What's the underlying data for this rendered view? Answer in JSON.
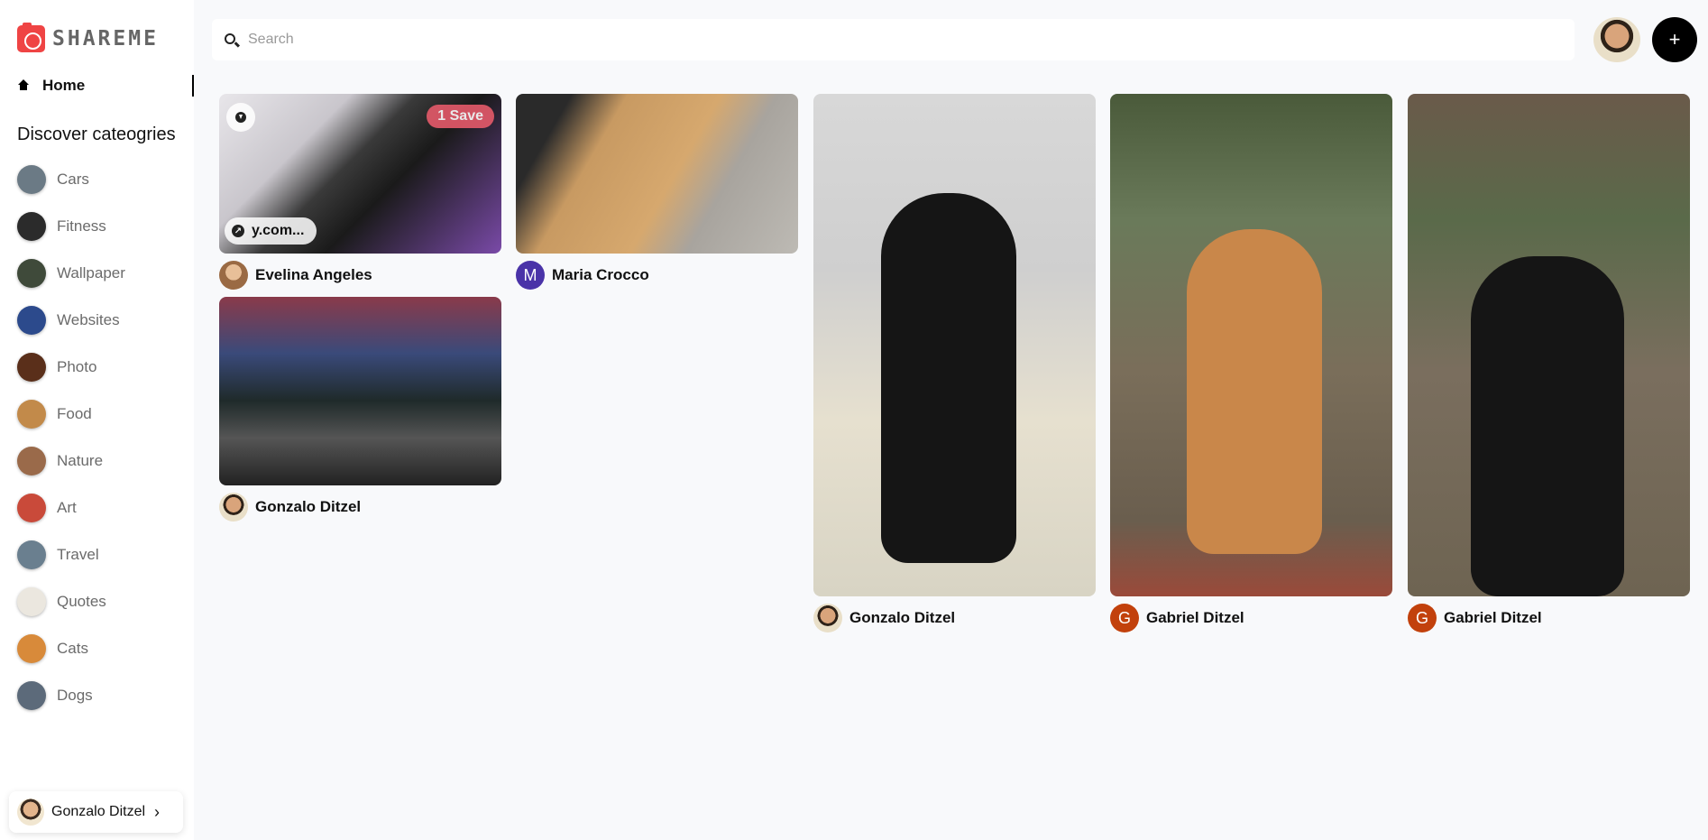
{
  "app": {
    "brand": "SHAREME"
  },
  "sidebar": {
    "home_label": "Home",
    "discover_title": "Discover cateogries",
    "categories": [
      {
        "label": "Cars",
        "thumb": "#6b7a85"
      },
      {
        "label": "Fitness",
        "thumb": "#2b2b2b"
      },
      {
        "label": "Wallpaper",
        "thumb": "#3f4a3a"
      },
      {
        "label": "Websites",
        "thumb": "#2c4a8c"
      },
      {
        "label": "Photo",
        "thumb": "#5a2f1a"
      },
      {
        "label": "Food",
        "thumb": "#c28a4a"
      },
      {
        "label": "Nature",
        "thumb": "#9a6a4a"
      },
      {
        "label": "Art",
        "thumb": "#c94a3a"
      },
      {
        "label": "Travel",
        "thumb": "#6a7f8f"
      },
      {
        "label": "Quotes",
        "thumb": "#ebe7df"
      },
      {
        "label": "Cats",
        "thumb": "#d88a3a"
      },
      {
        "label": "Dogs",
        "thumb": "#5c6a7a"
      }
    ],
    "user": {
      "name": "Gonzalo Ditzel"
    }
  },
  "topbar": {
    "search_placeholder": "Search",
    "add_icon": "plus-icon"
  },
  "pins": [
    {
      "author": "Evelina Angeles",
      "initial": "",
      "avatar_color": "#c9956a",
      "save_label": "1 Save",
      "link_text": "y.com...",
      "bg": "#4a4a55"
    },
    {
      "author": "Maria Crocco",
      "initial": "M",
      "avatar_color": "#4a33a8",
      "bg": "#b59a78"
    },
    {
      "author": "Gonzalo Ditzel",
      "initial": "",
      "avatar_color": "#d9a47b",
      "bg": "#2a2a3a"
    },
    {
      "author": "Gonzalo Ditzel",
      "initial": "",
      "avatar_color": "#d9a47b",
      "bg": "#c8c8c4"
    },
    {
      "author": "Gabriel Ditzel",
      "initial": "G",
      "avatar_color": "#c2410c",
      "bg": "#6a6a52"
    },
    {
      "author": "Gabriel Ditzel",
      "initial": "G",
      "avatar_color": "#c2410c",
      "bg": "#6e6450"
    }
  ]
}
